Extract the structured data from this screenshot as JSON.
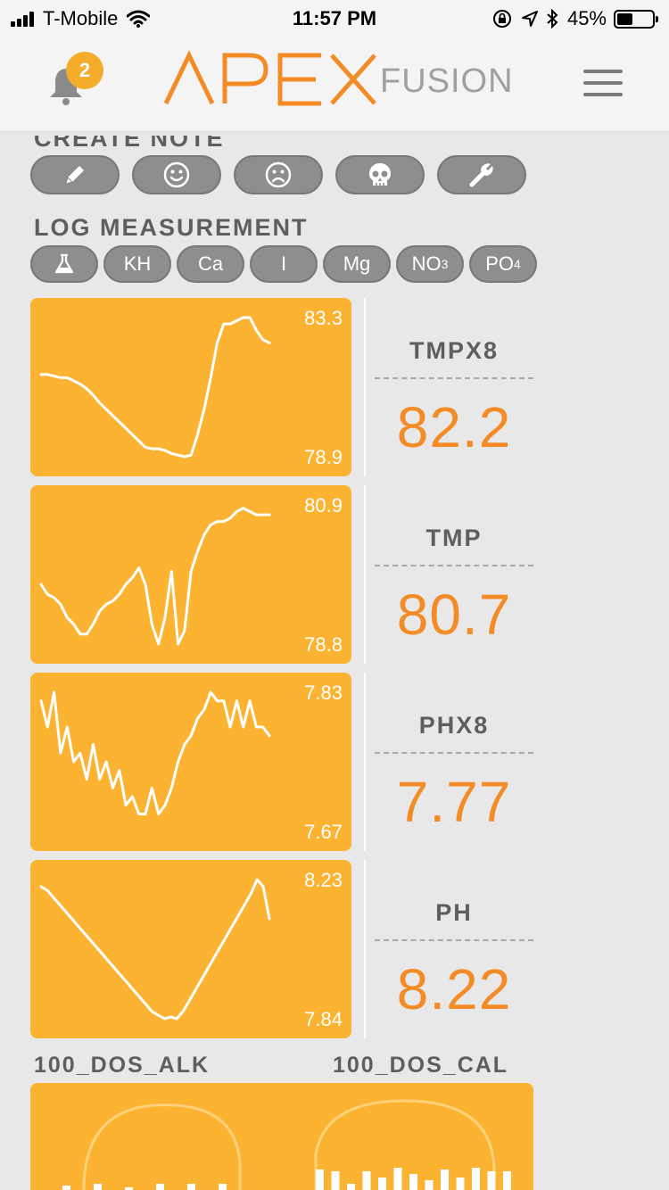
{
  "status_bar": {
    "carrier": "T-Mobile",
    "time": "11:57 PM",
    "battery": "45%",
    "battery_level": 0.45
  },
  "header": {
    "notification_count": "2",
    "logo_main": "APEX",
    "logo_sub": "FUSION"
  },
  "create_note": {
    "label": "CREATE NOTE",
    "buttons": [
      {
        "icon": "pencil-icon"
      },
      {
        "icon": "smiley-happy-icon"
      },
      {
        "icon": "smiley-sad-icon"
      },
      {
        "icon": "skull-icon"
      },
      {
        "icon": "wrench-icon"
      }
    ]
  },
  "log_measurement": {
    "label": "LOG MEASUREMENT",
    "buttons": [
      {
        "label": "",
        "icon": "flask-icon"
      },
      {
        "label": "KH"
      },
      {
        "label": "Ca"
      },
      {
        "label": "I"
      },
      {
        "label": "Mg"
      },
      {
        "label": "NO",
        "sub": "3"
      },
      {
        "label": "PO",
        "sub": "4"
      }
    ]
  },
  "probes": [
    {
      "name": "TMPX8",
      "value": "82.2",
      "max": "83.3",
      "min": "78.9",
      "trend": [
        81.5,
        81.5,
        81.45,
        81.4,
        81.4,
        81.3,
        81.2,
        81.05,
        80.85,
        80.6,
        80.4,
        80.2,
        80.0,
        79.8,
        79.6,
        79.4,
        79.2,
        79.15,
        79.15,
        79.1,
        79.0,
        78.95,
        78.9,
        78.95,
        79.6,
        80.4,
        81.4,
        82.5,
        83.1,
        83.1,
        83.2,
        83.3,
        83.3,
        82.9,
        82.6,
        82.5
      ]
    },
    {
      "name": "TMP",
      "value": "80.7",
      "max": "80.9",
      "min": "78.8",
      "trend": [
        79.7,
        79.55,
        79.5,
        79.4,
        79.2,
        79.1,
        78.95,
        78.95,
        79.1,
        79.3,
        79.4,
        79.45,
        79.55,
        79.7,
        79.8,
        79.95,
        79.7,
        79.1,
        78.8,
        79.2,
        79.9,
        78.8,
        79.0,
        79.9,
        80.2,
        80.45,
        80.6,
        80.65,
        80.65,
        80.7,
        80.8,
        80.85,
        80.8,
        80.75,
        80.75,
        80.75
      ]
    },
    {
      "name": "PHX8",
      "value": "7.77",
      "max": "7.83",
      "min": "7.67",
      "trend": [
        7.82,
        7.79,
        7.83,
        7.76,
        7.79,
        7.75,
        7.76,
        7.73,
        7.77,
        7.73,
        7.75,
        7.72,
        7.74,
        7.7,
        7.71,
        7.69,
        7.69,
        7.72,
        7.69,
        7.7,
        7.72,
        7.75,
        7.77,
        7.78,
        7.8,
        7.81,
        7.83,
        7.82,
        7.82,
        7.79,
        7.82,
        7.79,
        7.82,
        7.79,
        7.79,
        7.78
      ]
    },
    {
      "name": "PH",
      "value": "8.22",
      "max": "8.23",
      "min": "7.84",
      "trend": [
        8.21,
        8.2,
        8.18,
        8.16,
        8.14,
        8.12,
        8.1,
        8.08,
        8.06,
        8.04,
        8.02,
        8.0,
        7.98,
        7.96,
        7.94,
        7.92,
        7.9,
        7.88,
        7.86,
        7.85,
        7.84,
        7.845,
        7.84,
        7.86,
        7.89,
        7.92,
        7.95,
        7.98,
        8.01,
        8.04,
        8.07,
        8.1,
        8.13,
        8.16,
        8.19,
        8.23,
        8.21,
        8.12
      ]
    }
  ],
  "dos": {
    "left_label": "100_DOS_ALK",
    "right_label": "100_DOS_CAL",
    "left_bars": [
      0.55,
      0.25,
      0.6,
      0.35,
      0.5,
      0.3,
      0.6,
      0.35,
      0.6,
      0.4,
      0.6,
      0.25,
      0.35
    ],
    "right_bars": [
      0.95,
      0.9,
      0.6,
      0.9,
      0.75,
      1.0,
      0.85,
      0.7,
      0.95,
      0.75,
      1.0,
      0.9,
      0.9
    ]
  },
  "colors": {
    "tile": "#fbb331",
    "accent_orange": "#f38b27",
    "badge": "#f4ac2b",
    "pill": "#8e8e8e",
    "label_gray": "#5e5e5e"
  }
}
